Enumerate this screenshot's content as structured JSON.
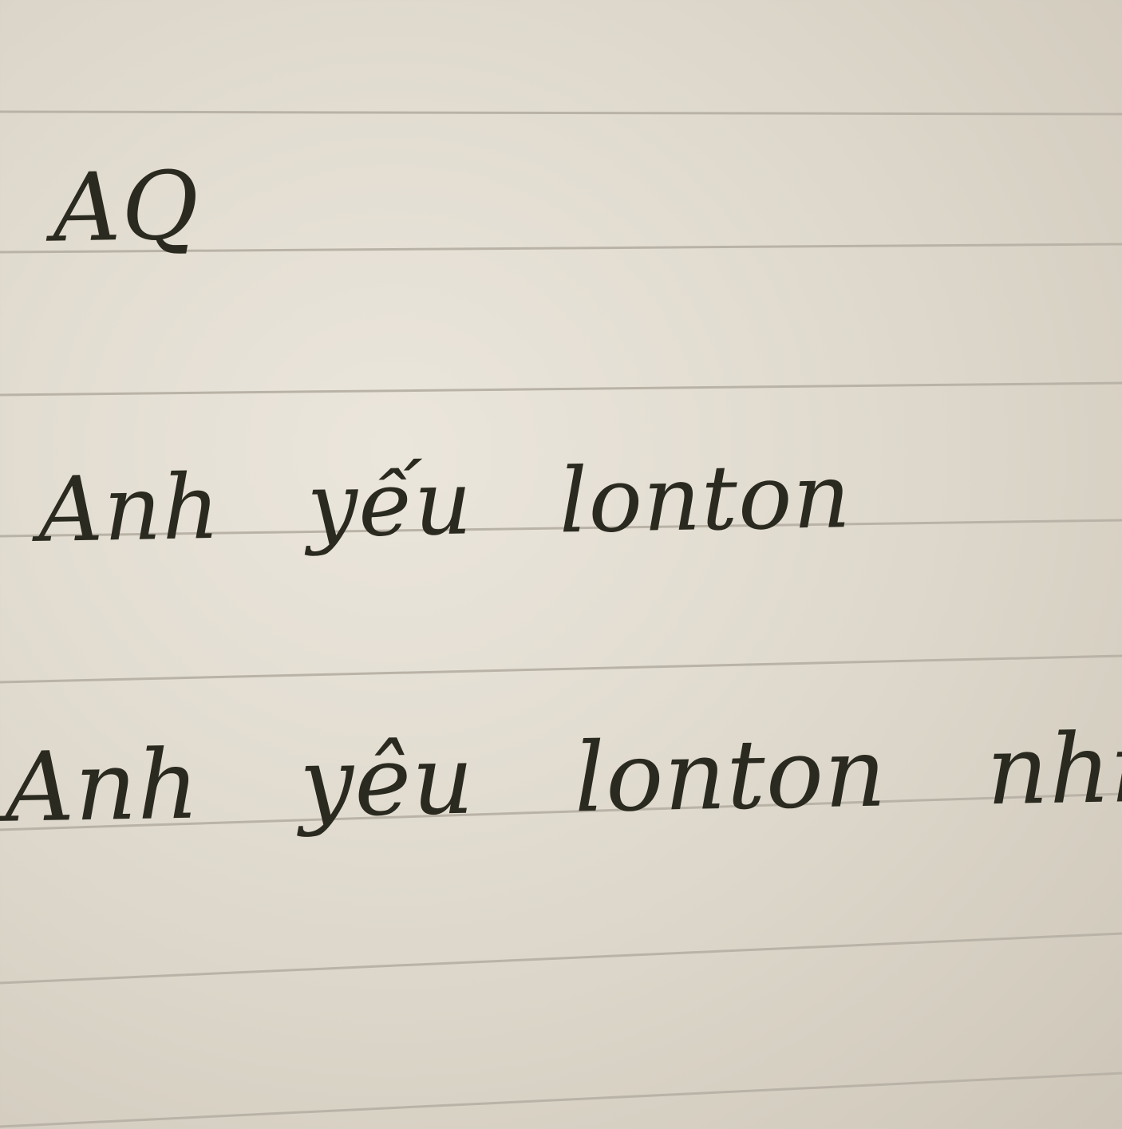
{
  "note": {
    "lines": [
      "AQ",
      "Anh yếu lonton",
      "Anh yêu lonton nhiều"
    ]
  },
  "colors": {
    "paper": "#e4dfd4",
    "rule": "#b9b2a6",
    "ink": "#2b2a20"
  }
}
